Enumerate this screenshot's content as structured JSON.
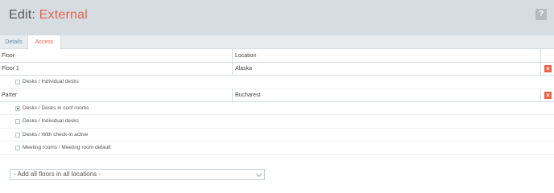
{
  "header": {
    "title_prefix": "Edit: ",
    "title_name": "External",
    "help_label": "?"
  },
  "tabs": [
    {
      "label": "Details",
      "active": false
    },
    {
      "label": "Access",
      "active": true
    }
  ],
  "table": {
    "columns": [
      "Floor",
      "Location"
    ],
    "groups": [
      {
        "floor": "Floor 1",
        "location": "Alaska",
        "delete_label": "×",
        "items": [
          {
            "label": "Desks / Individual desks",
            "checked": false
          }
        ]
      },
      {
        "floor": "Parter",
        "location": "Bucharest",
        "delete_label": "×",
        "items": [
          {
            "label": "Desks / Desks in conf rooms",
            "checked": true
          },
          {
            "label": "Desks / Individual desks",
            "checked": false
          },
          {
            "label": "Desks / With check-in active",
            "checked": false
          },
          {
            "label": "Meeting rooms / Meeting room default",
            "checked": false
          }
        ]
      }
    ]
  },
  "add_select": {
    "value": "- Add all floors in all locations -"
  },
  "colors": {
    "accent": "#e8634a",
    "header_bg": "#d5dde3",
    "tab_link": "#5b8fb0"
  }
}
